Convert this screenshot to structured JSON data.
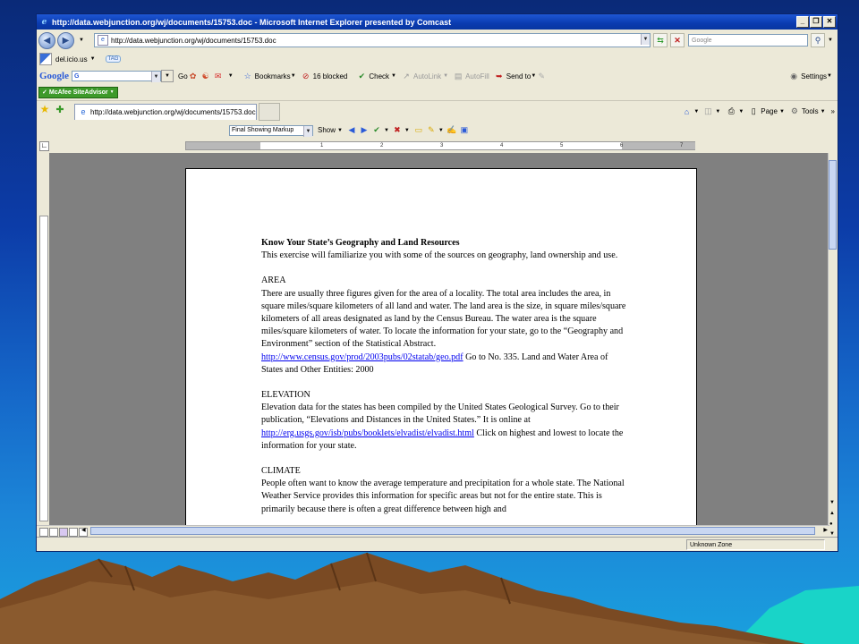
{
  "window": {
    "title": "http://data.webjunction.org/wj/documents/15753.doc - Microsoft Internet Explorer presented by Comcast",
    "min": "_",
    "max": "❐",
    "close": "✕"
  },
  "address_bar": {
    "url": "http://data.webjunction.org/wj/documents/15753.doc",
    "search_placeholder": "Google"
  },
  "delicious": {
    "label": "del.icio.us",
    "tag": "TAG"
  },
  "google_toolbar": {
    "logo": "Google",
    "g_button": "G",
    "go": "Go",
    "bookmarks": "Bookmarks",
    "blocked": "16 blocked",
    "check": "Check",
    "autolink": "AutoLink",
    "autofill": "AutoFill",
    "send_to": "Send to",
    "settings": "Settings"
  },
  "mcafee": {
    "label": "McAfee SiteAdvisor"
  },
  "tabs": {
    "active_tab": "http://data.webjunction.org/wj/documents/15753.doc",
    "page_menu": "Page",
    "tools_menu": "Tools"
  },
  "word_toolbar": {
    "markup": "Final Showing Markup",
    "show": "Show"
  },
  "ruler": {
    "ticks": [
      "1",
      "2",
      "3",
      "4",
      "5",
      "6",
      "7"
    ]
  },
  "document": {
    "heading": "Know Your State’s Geography and Land Resources",
    "intro": "This exercise will familiarize you with some of the sources on geography, land ownership and use.",
    "area_heading": "AREA",
    "area_text": "There are usually three figures given for the area of a locality. The total area includes the area, in square miles/square kilometers of all land and water. The land area is the size, in square miles/square kilometers of all areas designated as land by the Census Bureau. The water area is the square miles/square kilometers of water. To locate the information for your state, go to the “Geography and Environment” section of the Statistical Abstract.",
    "area_link": "http://www.census.gov/prod/2003pubs/02statab/geo.pdf",
    "area_after": " Go to No. 335. Land and Water Area of States and Other Entities: 2000",
    "elev_heading": "ELEVATION",
    "elev_text": "Elevation data for the states has been compiled by the United States Geological Survey. Go to their publication, “Elevations and Distances in the United States.” It is online at",
    "elev_link": "http://erg.usgs.gov/isb/pubs/booklets/elvadist/elvadist.html",
    "elev_after": " Click on highest and lowest to locate the information for your state.",
    "climate_heading": "CLIMATE",
    "climate_text": "People often want to know the average temperature and precipitation for a whole state. The National Weather Service provides this information for specific areas but not for the entire state. This is primarily because there is often a great difference between high and"
  },
  "status": {
    "zone": "Unknown Zone"
  }
}
